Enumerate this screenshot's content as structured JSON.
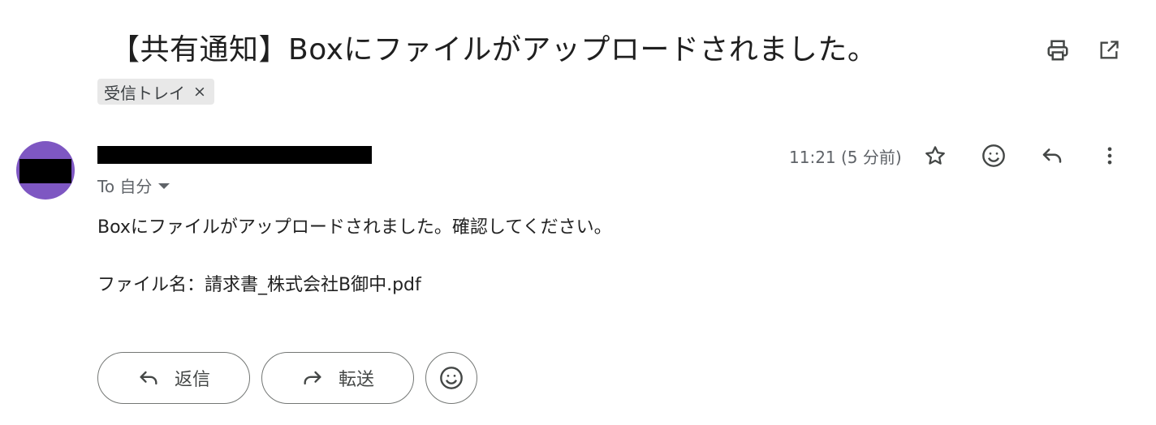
{
  "email": {
    "subject": "【共有通知】Boxにファイルがアップロードされました。",
    "label": "受信トレイ",
    "label_remove": "×",
    "to_line": "To 自分",
    "timestamp": "11:21 (5 分前)",
    "body_line1": "Boxにファイルがアップロードされました。確認してください。",
    "body_line2": "ファイル名：請求書_株式会社B御中.pdf"
  },
  "actions": {
    "reply_label": "返信",
    "forward_label": "転送"
  },
  "icons": {
    "print": "print-icon",
    "popout": "open-in-new-window-icon",
    "star": "star-icon",
    "emoji": "emoji-reaction-icon",
    "reply": "reply-icon",
    "more": "more-vert-icon",
    "forward": "forward-icon"
  },
  "colors": {
    "avatar": "#7e57c2",
    "chip_bg": "#e8e8e8",
    "secondary_text": "#5f6368",
    "redaction": "#000000"
  }
}
